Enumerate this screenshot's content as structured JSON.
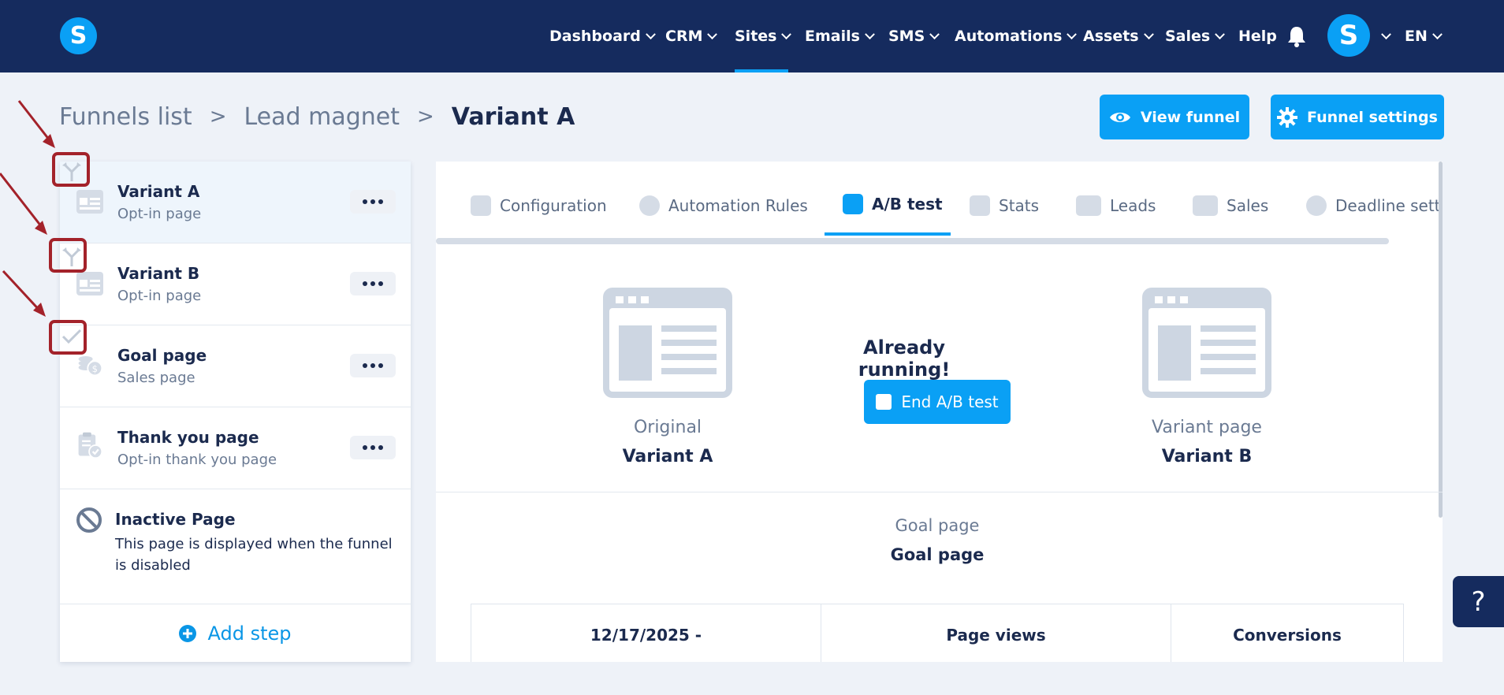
{
  "nav": {
    "items": [
      {
        "label": "Dashboard"
      },
      {
        "label": "CRM"
      },
      {
        "label": "Sites"
      },
      {
        "label": "Emails"
      },
      {
        "label": "SMS"
      },
      {
        "label": "Automations"
      },
      {
        "label": "Assets"
      },
      {
        "label": "Sales"
      },
      {
        "label": "Help"
      }
    ],
    "active": "Sites",
    "logo_letter": "S",
    "avatar_letter": "S",
    "language": "EN"
  },
  "breadcrumb": {
    "items": [
      "Funnels list",
      "Lead magnet",
      "Variant A"
    ],
    "separator": ">"
  },
  "header_buttons": {
    "view_funnel": "View funnel",
    "funnel_settings": "Funnel settings"
  },
  "sidebar": {
    "steps": [
      {
        "title": "Variant A",
        "subtitle": "Opt-in page",
        "selected": true,
        "icon": "page-layout-icon",
        "marker": "split-test-icon"
      },
      {
        "title": "Variant B",
        "subtitle": "Opt-in page",
        "selected": false,
        "icon": "page-layout-icon",
        "marker": "split-test-icon"
      },
      {
        "title": "Goal page",
        "subtitle": "Sales page",
        "selected": false,
        "icon": "coins-dollar-icon",
        "marker": "checkmark-icon"
      },
      {
        "title": "Thank you page",
        "subtitle": "Opt-in thank you page",
        "selected": false,
        "icon": "clipboard-check-icon"
      }
    ],
    "inactive": {
      "title": "Inactive Page",
      "description": "This page is displayed when the funnel is disabled"
    },
    "add_step": "Add step"
  },
  "tabs": [
    {
      "label": "Configuration",
      "icon": "sliders-icon"
    },
    {
      "label": "Automation Rules",
      "icon": "lightning-icon"
    },
    {
      "label": "A/B test",
      "icon": "split-test-icon",
      "active": true
    },
    {
      "label": "Stats",
      "icon": "bar-chart-icon"
    },
    {
      "label": "Leads",
      "icon": "people-icon"
    },
    {
      "label": "Sales",
      "icon": "dollar-icon"
    },
    {
      "label": "Deadline sett",
      "icon": "clock-icon"
    }
  ],
  "ab_test": {
    "status": "Already running!",
    "end_button": "End A/B test",
    "original": {
      "caption": "Original",
      "name": "Variant A"
    },
    "variant": {
      "caption": "Variant page",
      "name": "Variant B"
    },
    "goal": {
      "caption": "Goal page",
      "name": "Goal page"
    }
  },
  "stats_table": {
    "headers": [
      "12/17/2025 -",
      "Page views",
      "Conversions"
    ]
  },
  "help_button": "?",
  "colors": {
    "nav_bg": "#152b5e",
    "accent": "#0aa0f5",
    "annotation": "#a3222a"
  }
}
